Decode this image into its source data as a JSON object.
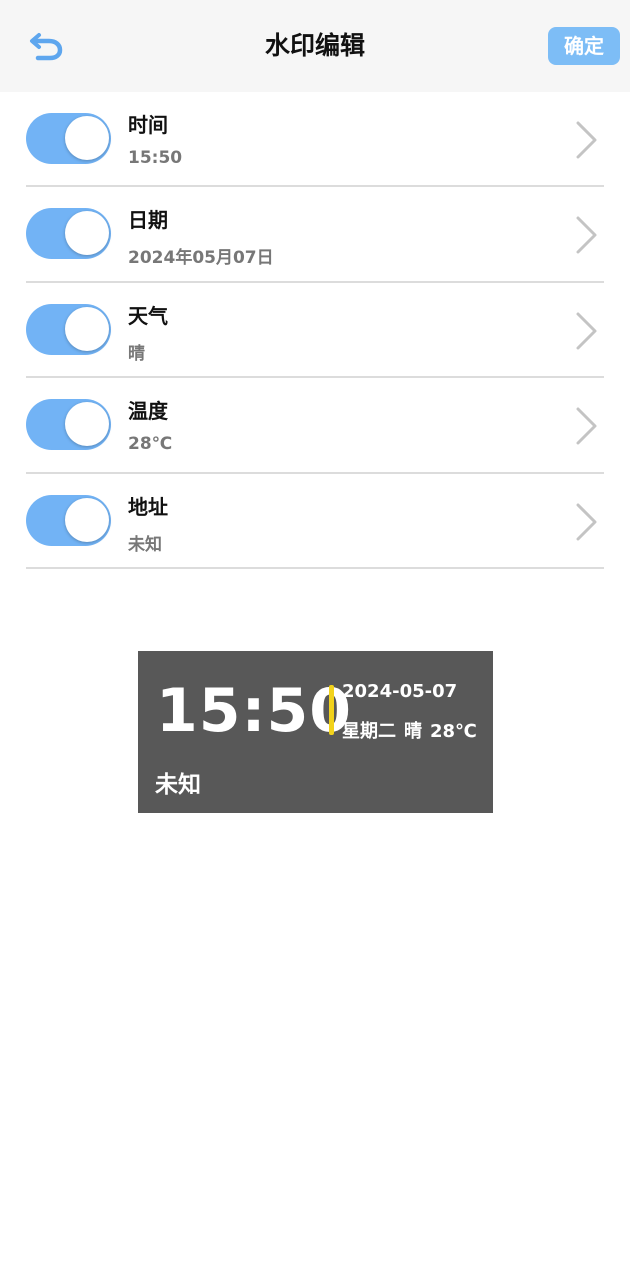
{
  "header": {
    "title": "水印编辑",
    "confirm_label": "确定",
    "back_icon": "back-arrow-icon",
    "accent_color": "#7dbdf6"
  },
  "settings": {
    "items": [
      {
        "label": "时间",
        "value": "15:50",
        "enabled": true
      },
      {
        "label": "日期",
        "value": "2024年05月07日",
        "enabled": true
      },
      {
        "label": "天气",
        "value": "晴",
        "enabled": true
      },
      {
        "label": "温度",
        "value": "28℃",
        "enabled": true
      },
      {
        "label": "地址",
        "value": "未知",
        "enabled": true
      }
    ],
    "toggle_color": "#72b3f5",
    "chevron_icon": "chevron-right-icon"
  },
  "watermark": {
    "time": "15:50",
    "date": "2024-05-07",
    "weekday": "星期二",
    "weather": "晴",
    "temperature": "28℃",
    "address": "未知",
    "accent_color": "#f2d21b"
  }
}
